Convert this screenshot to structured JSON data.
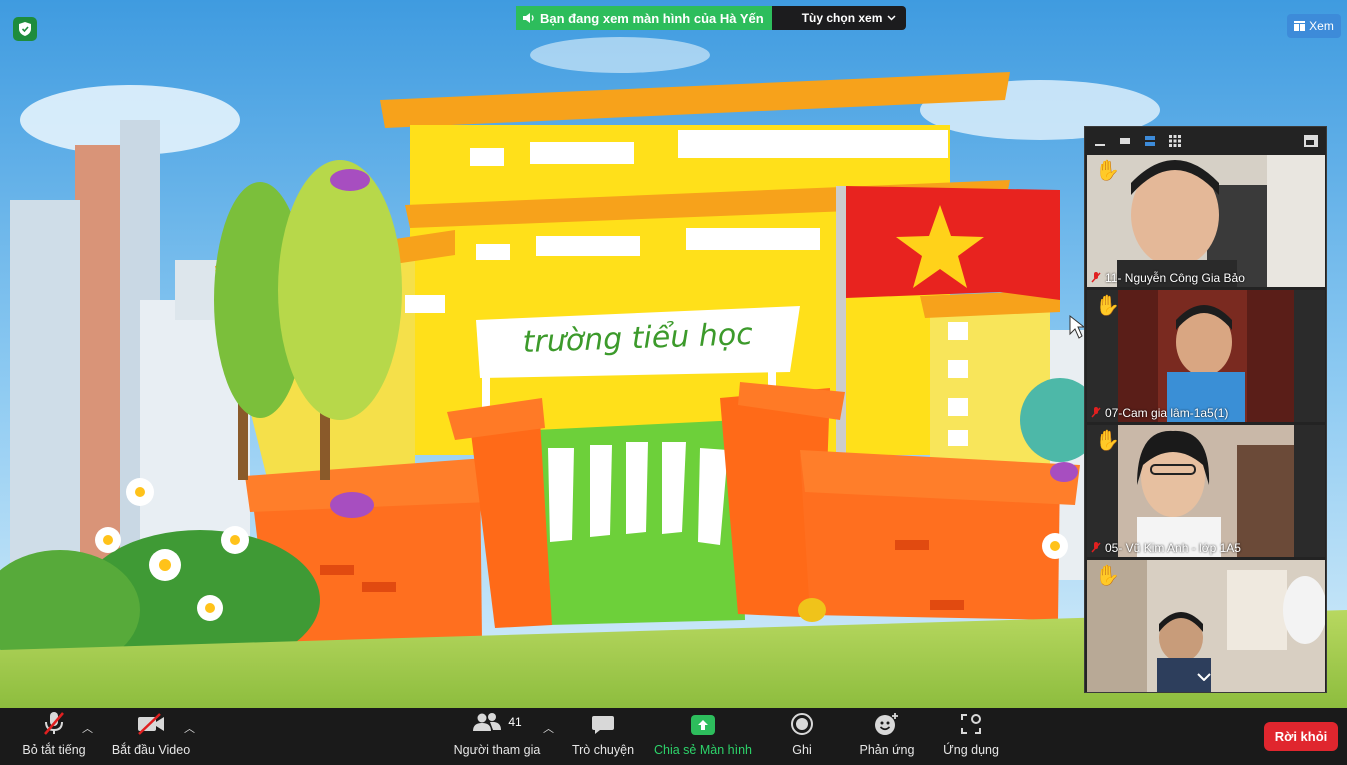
{
  "banner": {
    "speaker_icon": "speaker-icon",
    "viewing_text": "Bạn đang xem màn hình của Hà Yến",
    "options_label": "Tùy chọn xem"
  },
  "top_right": {
    "view_label": "Xem"
  },
  "shared_content": {
    "sign_text": "trường tiểu học"
  },
  "participants": [
    {
      "name": "11- Nguyễn Công Gia Bảo",
      "hand_raised": true,
      "muted": true
    },
    {
      "name": "07-Cam gia lâm-1a5(1)",
      "hand_raised": true,
      "muted": true
    },
    {
      "name": "05- Vũ Kim Anh - lớp 1A5",
      "hand_raised": true,
      "muted": true
    },
    {
      "name": "",
      "hand_raised": true,
      "muted": false
    }
  ],
  "toolbar": {
    "mute_all": "Bỏ tắt tiếng",
    "start_video": "Bắt đầu Video",
    "participants_label": "Người tham gia",
    "participants_count": "41",
    "chat": "Trò chuyện",
    "share_screen": "Chia sẻ Màn hình",
    "record": "Ghi",
    "reactions": "Phản ứng",
    "apps": "Ứng dụng",
    "leave": "Rời khỏi"
  },
  "colors": {
    "share_green": "#2dbd5c",
    "leave_red": "#e0262e",
    "view_blue": "#3d8bd9",
    "toolbar_bg": "#1a1a1a"
  }
}
